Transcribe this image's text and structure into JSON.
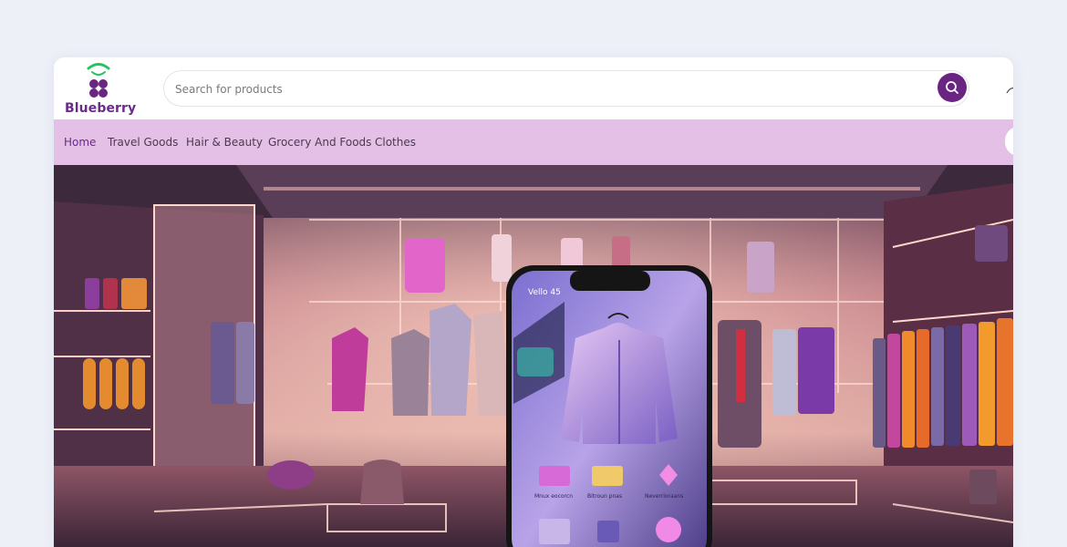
{
  "brand": {
    "name": "Blueberry"
  },
  "search": {
    "placeholder": "Search for products"
  },
  "nav": {
    "items": [
      {
        "label": "Home",
        "active": true
      },
      {
        "label": "Travel Goods"
      },
      {
        "label": "Hair & Beauty"
      },
      {
        "label": "Grocery And Foods"
      },
      {
        "label": "Clothes"
      }
    ]
  },
  "hero": {
    "phone_top_text": "Vello 45",
    "phone_labels": [
      "Mnux eocorcn",
      "Bitroun pnas",
      "Neverrioraans"
    ]
  },
  "colors": {
    "brand": "#6a2582",
    "nav_bg": "#e4c0e6",
    "page_bg": "#eef0f8",
    "logo_green": "#22c55e"
  },
  "icons": {
    "search": "search-icon",
    "user": "user-icon",
    "logo": "blueberry-logo-icon"
  }
}
